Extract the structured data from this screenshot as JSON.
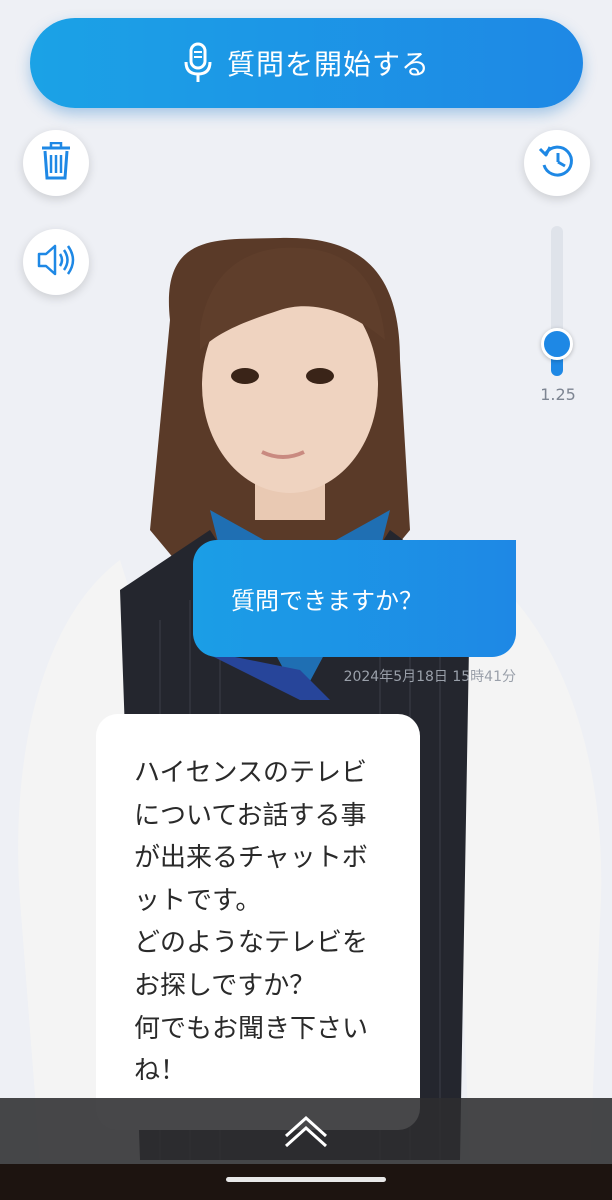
{
  "header": {
    "start_button_label": "質問を開始する"
  },
  "controls": {
    "trash_icon": "trash-icon",
    "speaker_icon": "speaker-icon",
    "history_icon": "history-icon",
    "speed_value": "1.25",
    "speed_level": 1.25
  },
  "chat": {
    "user_message": "質問できますか？",
    "user_timestamp": "2024年5月18日 15時41分",
    "bot_message": "ハイセンスのテレビについてお話する事が出来るチャットボットです。\nどのようなテレビをお探しですか？\n何でもお聞き下さいね！"
  },
  "footer": {
    "expand_icon": "chevron-up-double-icon"
  },
  "colors": {
    "accent": "#1e88e5",
    "accent_light": "#1ba2e6"
  }
}
